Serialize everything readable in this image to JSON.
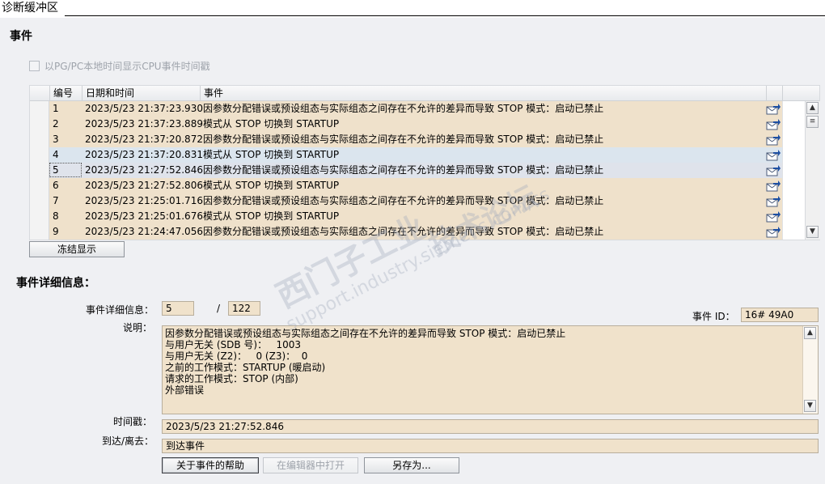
{
  "window": {
    "title": "诊断缓冲区"
  },
  "events_section": {
    "title": "事件"
  },
  "local_time_checkbox": {
    "label": "以PG/PC本地时间显示CPU事件时间戳",
    "checked": false,
    "enabled": false
  },
  "table": {
    "headers": {
      "num": "编号",
      "datetime": "日期和时间",
      "event": "事件"
    },
    "rows": [
      {
        "num": "1",
        "datetime": "2023/5/23 21:37:23.930",
        "event": "因参数分配错误或预设组态与实际组态之间存在不允许的差异而导致 STOP 模式：启动已禁止",
        "bg": "#efe1cb"
      },
      {
        "num": "2",
        "datetime": "2023/5/23 21:37:23.889",
        "event": "模式从 STOP 切换到 STARTUP",
        "bg": "#efe1cb"
      },
      {
        "num": "3",
        "datetime": "2023/5/23 21:37:20.872",
        "event": "因参数分配错误或预设组态与实际组态之间存在不允许的差异而导致 STOP 模式：启动已禁止",
        "bg": "#efe1cb"
      },
      {
        "num": "4",
        "datetime": "2023/5/23 21:37:20.831",
        "event": "模式从 STOP 切换到 STARTUP",
        "bg": "#dbe5ee"
      },
      {
        "num": "5",
        "datetime": "2023/5/23 21:27:52.846",
        "event": "因参数分配错误或预设组态与实际组态之间存在不允许的差异而导致 STOP 模式：启动已禁止",
        "bg": "#dfe3eb"
      },
      {
        "num": "6",
        "datetime": "2023/5/23 21:27:52.806",
        "event": "模式从 STOP 切换到 STARTUP",
        "bg": "#efe1cb"
      },
      {
        "num": "7",
        "datetime": "2023/5/23 21:25:01.716",
        "event": "因参数分配错误或预设组态与实际组态之间存在不允许的差异而导致 STOP 模式：启动已禁止",
        "bg": "#efe1cb"
      },
      {
        "num": "8",
        "datetime": "2023/5/23 21:25:01.676",
        "event": "模式从 STOP 切换到 STARTUP",
        "bg": "#efe1cb"
      },
      {
        "num": "9",
        "datetime": "2023/5/23 21:24:47.056",
        "event": "因参数分配错误或预设组态与实际组态之间存在不允许的差异而导致 STOP 模式：启动已禁止",
        "bg": "#efe1cb"
      }
    ],
    "selected_row": "5"
  },
  "freeze_button": {
    "label": "冻结显示"
  },
  "details": {
    "title": "事件详细信息：",
    "detail_label": "事件详细信息：",
    "detail_index": "5",
    "separator": "/",
    "detail_total": "122",
    "event_id_label": "事件 ID：",
    "event_id": "16# 49A0",
    "description_label": "说明：",
    "description_lines": [
      "因参数分配错误或预设组态与实际组态之间存在不允许的差异而导致 STOP 模式：启动已禁止",
      "与用户无关 (SDB 号)：   1003",
      "与用户无关 (Z2)：   0 (Z3)：  0",
      "之前的工作模式：STARTUP (暖启动)",
      "请求的工作模式：STOP (内部)",
      "外部错误"
    ],
    "timestamp_label": "时间戳：",
    "timestamp": "2023/5/23 21:27:52.846",
    "arrive_leave_label": "到达/离去：",
    "arrive_leave": "到达事件"
  },
  "buttons": {
    "help": "关于事件的帮助",
    "open_editor": "在编辑器中打开",
    "save_as": "另存为..."
  },
  "watermark": {
    "main": "西门子工业",
    "url": "support.industry.siemens.com/cs",
    "tag": "技术论坛"
  },
  "colors": {
    "panel": "#eff0f3",
    "field": "#f0e2cb",
    "row_default": "#efe1cb",
    "row_hover": "#dbe5ee",
    "row_selected": "#dfe3eb"
  }
}
